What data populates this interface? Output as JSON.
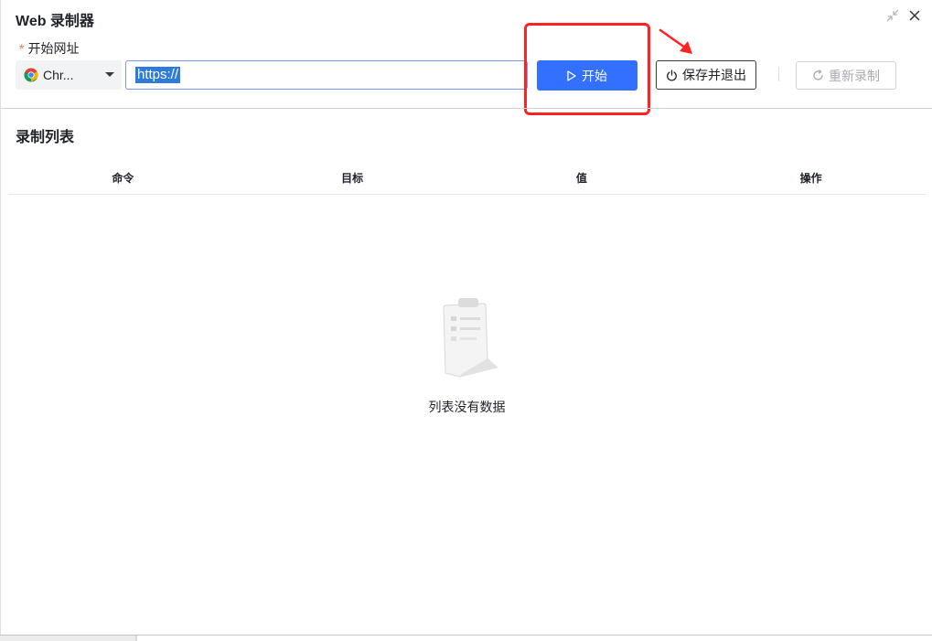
{
  "dialog": {
    "title": "Web 录制器",
    "close_label": "✕"
  },
  "form": {
    "url_label_required": "*",
    "url_label": "开始网址",
    "browser": {
      "selected": "Chr...",
      "icon": "chrome-icon"
    },
    "url_value": "https://"
  },
  "toolbar": {
    "start_label": "开始",
    "save_exit_label": "保存并退出",
    "rerecord_label": "重新录制"
  },
  "recording_list": {
    "title": "录制列表",
    "columns": [
      "命令",
      "目标",
      "值",
      "操作"
    ],
    "rows": [],
    "empty_text": "列表没有数据"
  },
  "colors": {
    "primary": "#3370ff",
    "highlight": "#ff2222",
    "required": "#f56c6c"
  }
}
